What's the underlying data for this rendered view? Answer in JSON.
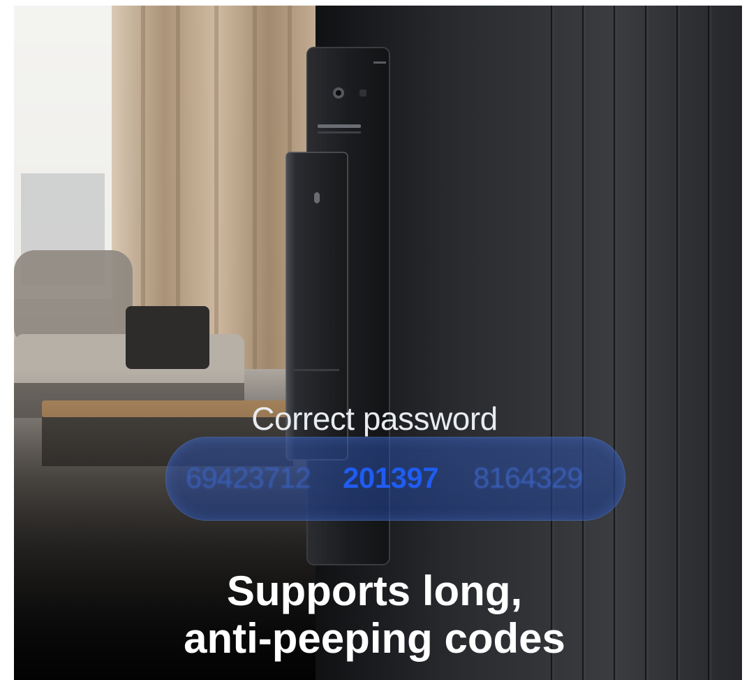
{
  "scene": {
    "subject": "smart-door-lock",
    "colors": {
      "wall": "#ffffff",
      "door": "#1e1f22",
      "curtain": "#bfa88f",
      "sofa": "#8b857e",
      "table": "#b08a62",
      "lock_body": "#141517",
      "pill": "#2d4fa3",
      "code_highlight": "#1f5cf0"
    }
  },
  "overlay": {
    "label": "Correct password",
    "codes": [
      "69423712",
      "201397",
      "8164329"
    ]
  },
  "headline": {
    "line1": "Supports long,",
    "line2": "anti-peeping codes"
  }
}
